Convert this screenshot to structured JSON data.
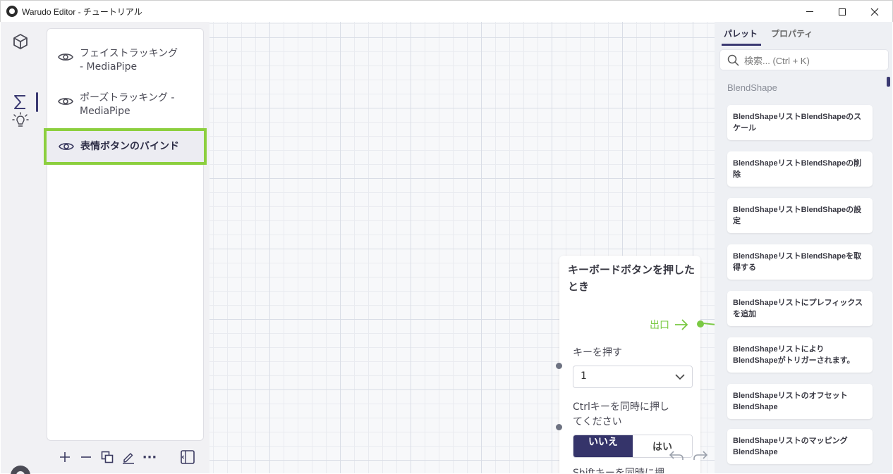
{
  "window": {
    "title": "Warudo Editor - チュートリアル",
    "controls": {
      "minimize": "minimize-icon",
      "maximize": "maximize-icon",
      "close": "close-icon"
    }
  },
  "rail": {
    "items": [
      {
        "name": "assets",
        "icon": "cube-icon",
        "active": false
      },
      {
        "name": "blueprints",
        "icon": "sigma-icon",
        "active": true
      },
      {
        "name": "plugins",
        "icon": "lightbulb-icon",
        "active": false
      }
    ],
    "bottom_icon": "warudo-logo-icon"
  },
  "graph_list": {
    "items": [
      {
        "label_line1": "フェイストラッキング",
        "label_line2": "- MediaPipe",
        "selected": false
      },
      {
        "label_line1": "ポーズトラッキング -",
        "label_line2": "MediaPipe",
        "selected": false
      },
      {
        "label_line1": "表情ボタンのバインド",
        "label_line2": "",
        "selected": true
      }
    ],
    "toolbar": [
      "plus-icon",
      "minus-icon",
      "duplicate-icon",
      "edit-icon",
      "more-icon",
      "collapse-panel-icon"
    ],
    "toolbar_more_label": "···"
  },
  "node": {
    "title": "キーボードボタンを押したとき",
    "output_label": "出口",
    "key_field_label": "キーを押す",
    "key_value": "1",
    "ctrl_label_line1": "Ctrlキーを同時に押し",
    "ctrl_label_line2": "てください",
    "toggle_no": "いいえ",
    "toggle_yes": "はい",
    "next_label": "Shiftキーを同時に押"
  },
  "right_panel": {
    "tabs": [
      {
        "label": "パレット",
        "active": true
      },
      {
        "label": "プロパティ",
        "active": false
      }
    ],
    "search_placeholder": "検索... (Ctrl + K)",
    "section": "BlendShape",
    "cards": [
      "BlendShapeリストBlendShapeのスケール",
      "BlendShapeリストBlendShapeの削除",
      "BlendShapeリストBlendShapeの設定",
      "BlendShapeリストBlendShapeを取得する",
      "BlendShapeリストにプレフィックスを追加",
      "BlendShapeリストによりBlendShapeがトリガーされます。",
      "BlendShapeリストのオフセットBlendShape",
      "BlendShapeリストのマッピングBlendShape"
    ]
  },
  "colors": {
    "accent": "#3b3a72",
    "selection_outline": "#8ccf3e",
    "flow_green": "#7ac943"
  }
}
